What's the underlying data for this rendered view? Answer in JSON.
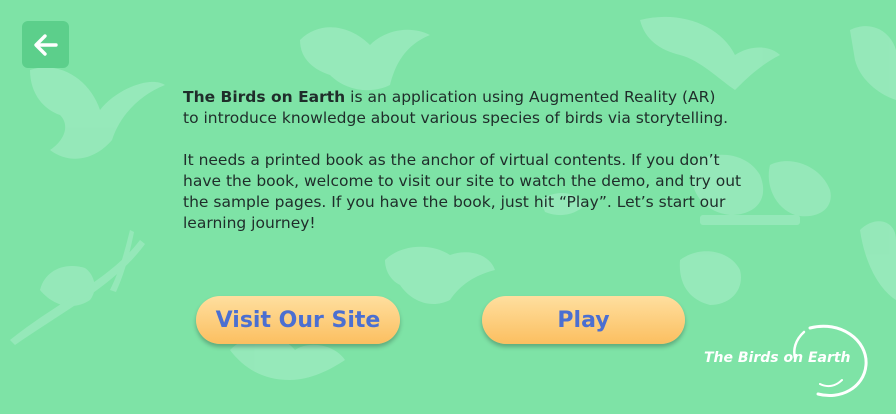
{
  "back_button": {
    "icon": "arrow-left-icon"
  },
  "description": {
    "app_name": "The Birds on Earth",
    "intro_line1": " is an application using Augmented Reality (AR)",
    "intro_line2": "to introduce knowledge about various species of birds via storytelling.",
    "paragraph2": "It needs a printed book as the anchor of virtual contents. If you don’t have the book, welcome to visit our site to watch the demo, and try out the sample pages. If you have the book, just hit “Play”. Let’s start our learning journey!"
  },
  "buttons": {
    "visit_site_label": "Visit Our Site",
    "play_label": "Play"
  },
  "brand": {
    "logo_text": "The Birds on Earth"
  },
  "colors": {
    "background": "#7ee3a6",
    "button_text": "#4b6fd1",
    "button_fill": "#fbbf60"
  }
}
